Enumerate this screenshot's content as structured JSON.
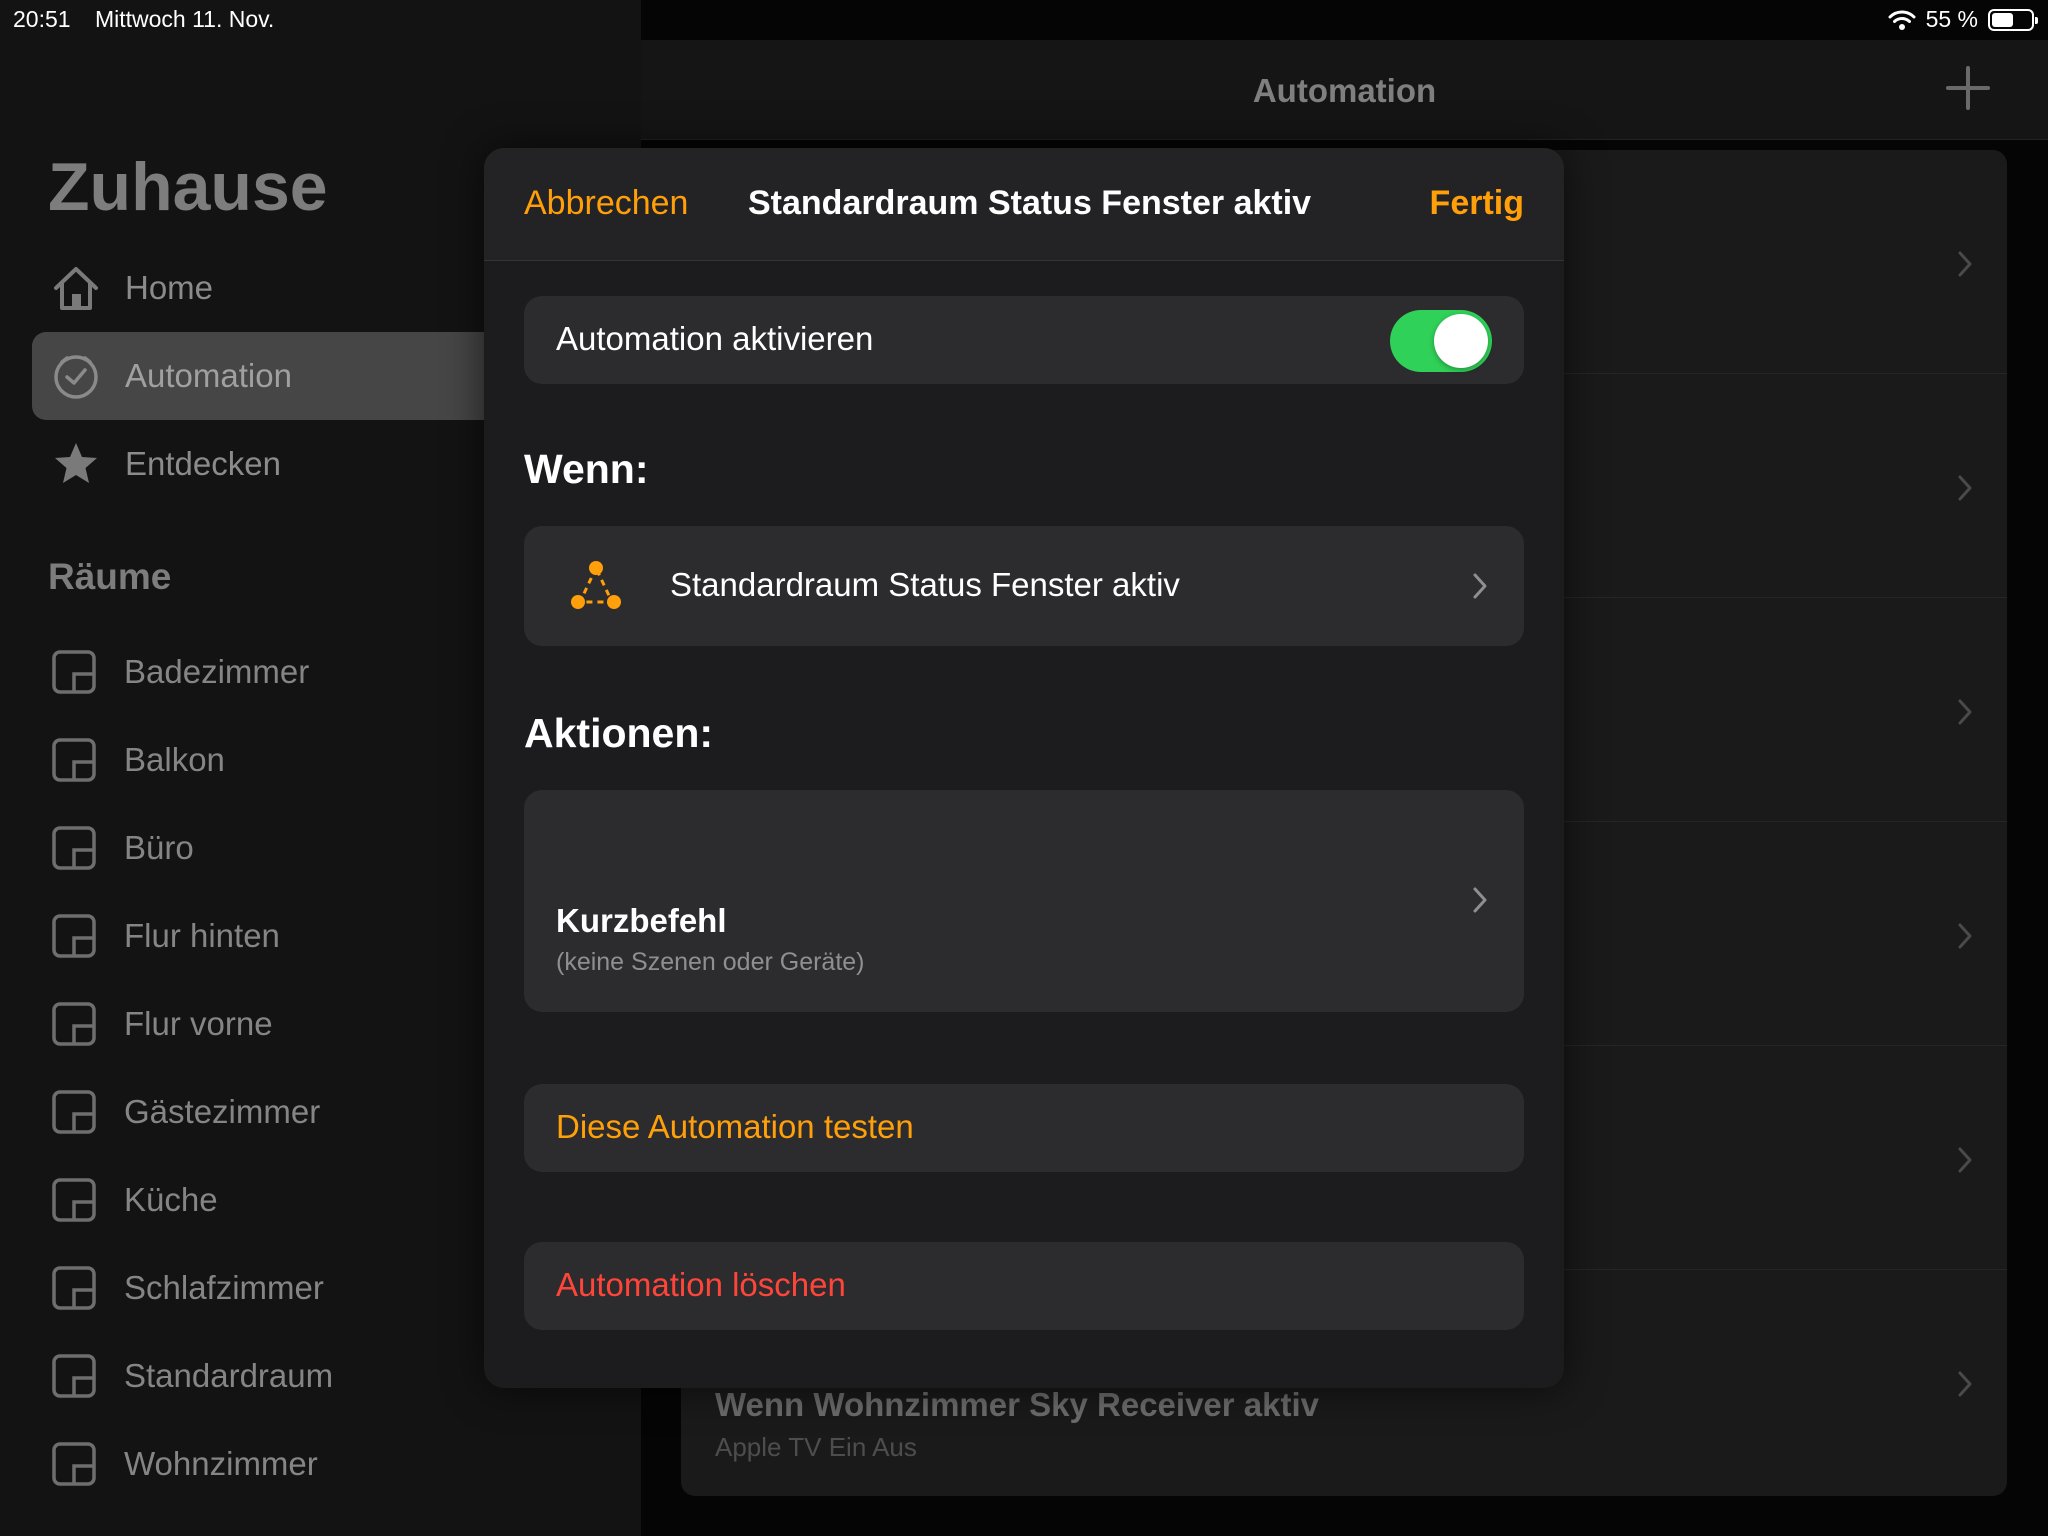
{
  "status_bar": {
    "time": "20:51",
    "date": "Mittwoch 11. Nov.",
    "battery_text": "55 %",
    "battery_level": 0.55,
    "icons": [
      "wifi-icon",
      "battery-icon"
    ]
  },
  "sidebar": {
    "title": "Zuhause",
    "nav": [
      {
        "label": "Home",
        "icon": "house-icon"
      },
      {
        "label": "Automation",
        "icon": "clock-icon",
        "active": true
      },
      {
        "label": "Entdecken",
        "icon": "star-icon"
      }
    ],
    "rooms_heading": "Räume",
    "rooms": [
      "Badezimmer",
      "Balkon",
      "Büro",
      "Flur hinten",
      "Flur vorne",
      "Gästezimmer",
      "Küche",
      "Schlafzimmer",
      "Standardraum",
      "Wohnzimmer"
    ]
  },
  "main": {
    "title": "Automation",
    "add_icon": "plus-icon",
    "visible_row": {
      "title": "Wenn Wohnzimmer Sky Receiver aktiv",
      "subtitle": "Apple TV Ein Aus"
    }
  },
  "modal": {
    "cancel_label": "Abbrechen",
    "title": "Standardraum Status Fenster aktiv",
    "done_label": "Fertig",
    "enable_label": "Automation aktivieren",
    "enabled": true,
    "when_heading": "Wenn:",
    "trigger_label": "Standardraum Status Fenster aktiv",
    "trigger_icon": "sensor-triangle-icon",
    "actions_heading": "Aktionen:",
    "action_title": "Kurzbefehl",
    "action_subtitle": "(keine Szenen oder Geräte)",
    "test_label": "Diese Automation testen",
    "delete_label": "Automation löschen"
  },
  "colors": {
    "accent": "#ff9f0a",
    "toggle_on": "#30d158",
    "destructive": "#ff453a"
  }
}
